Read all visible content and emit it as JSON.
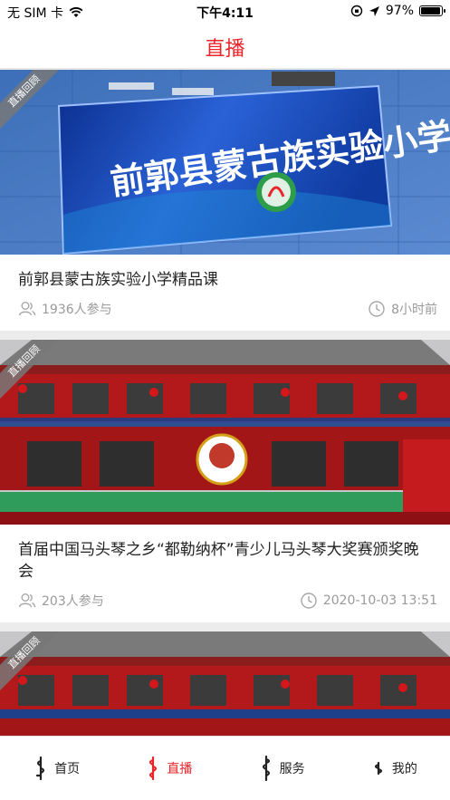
{
  "status": {
    "carrier": "无 SIM 卡",
    "time": "下午4:11",
    "battery": "97%",
    "battery_level": 0.97
  },
  "header": {
    "title": "直播"
  },
  "ribbon_label": "直播回顾",
  "cards": [
    {
      "title": "前郭县蒙古族实验小学精品课",
      "participants": "1936人参与",
      "time": "8小时前",
      "sign_text": "前郭县蒙古族实验小学"
    },
    {
      "title": "首届中国马头琴之乡“都勒纳杯”青少儿马头琴大奖赛颁奖晚会",
      "participants": "203人参与",
      "time": "2020-10-03 13:51"
    },
    {
      "title": "",
      "participants": "",
      "time": ""
    }
  ],
  "tabs": [
    {
      "label": "首页",
      "icon": "mongolian-script-icon"
    },
    {
      "label": "直播",
      "icon": "mongolian-script-icon"
    },
    {
      "label": "服务",
      "icon": "mongolian-script-icon"
    },
    {
      "label": "我的",
      "icon": "mongolian-script-icon"
    }
  ],
  "colors": {
    "accent": "#e8252a",
    "meta_gray": "#9a9a9a",
    "background": "#ececec"
  }
}
